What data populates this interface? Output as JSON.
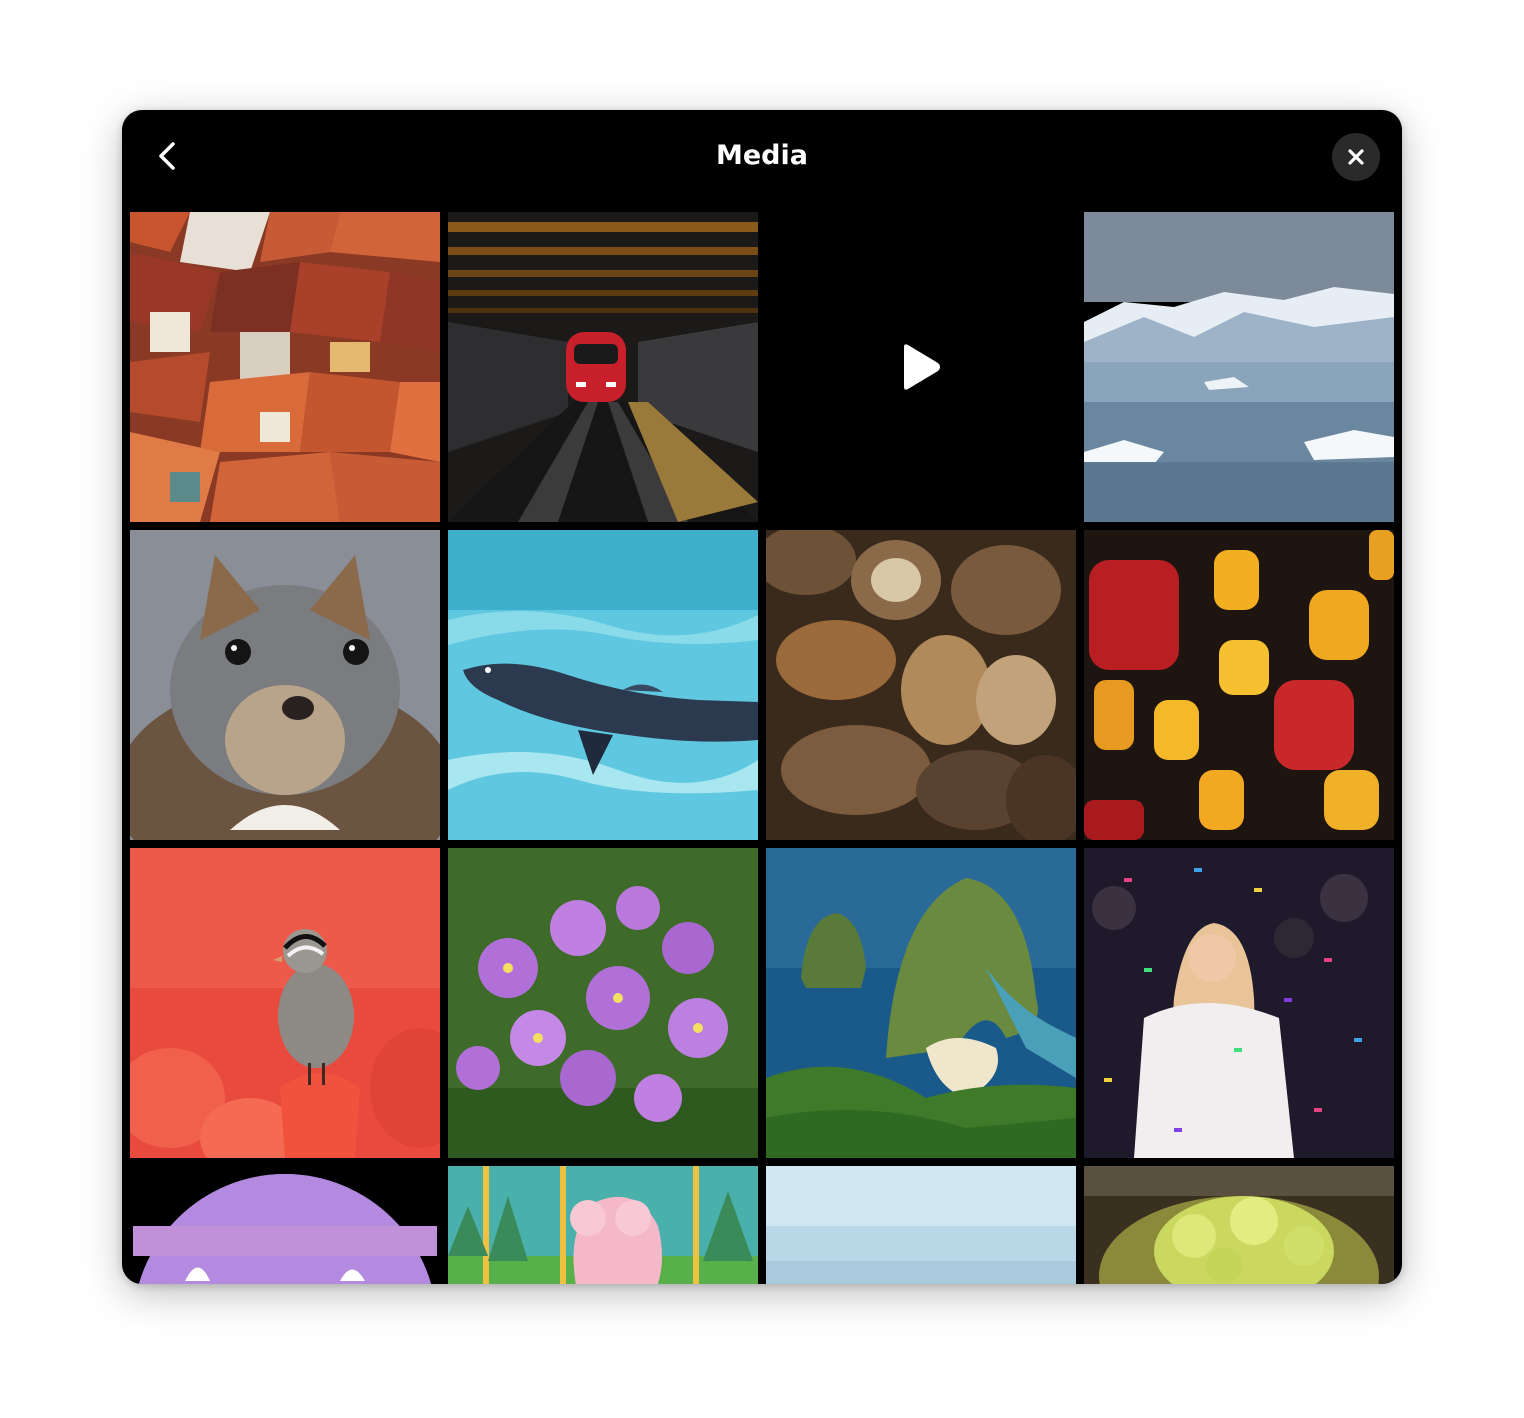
{
  "window": {
    "title": "Media",
    "back_icon": "chevron-left-icon",
    "close_icon": "close-icon"
  },
  "media": [
    {
      "kind": "image",
      "subject": "old-town-rooftops"
    },
    {
      "kind": "image",
      "subject": "train-in-station"
    },
    {
      "kind": "video",
      "subject": "video",
      "icon": "play-icon"
    },
    {
      "kind": "image",
      "subject": "icebergs-and-mountains"
    },
    {
      "kind": "image",
      "subject": "squirrel"
    },
    {
      "kind": "image",
      "subject": "penguin-swimming"
    },
    {
      "kind": "image",
      "subject": "nuts"
    },
    {
      "kind": "image",
      "subject": "lanterns"
    },
    {
      "kind": "image",
      "subject": "bird-on-tulips"
    },
    {
      "kind": "image",
      "subject": "purple-flowers"
    },
    {
      "kind": "image",
      "subject": "coastal-cliff"
    },
    {
      "kind": "image",
      "subject": "confetti-celebration"
    },
    {
      "kind": "image",
      "subject": "purple-sticker"
    },
    {
      "kind": "image",
      "subject": "cartoon-character"
    },
    {
      "kind": "image",
      "subject": "sea-horizon"
    },
    {
      "kind": "image",
      "subject": "romanesco"
    }
  ],
  "colors": {
    "window_bg": "#000000",
    "close_button_bg": "#2a2a2a",
    "text": "#ffffff"
  }
}
